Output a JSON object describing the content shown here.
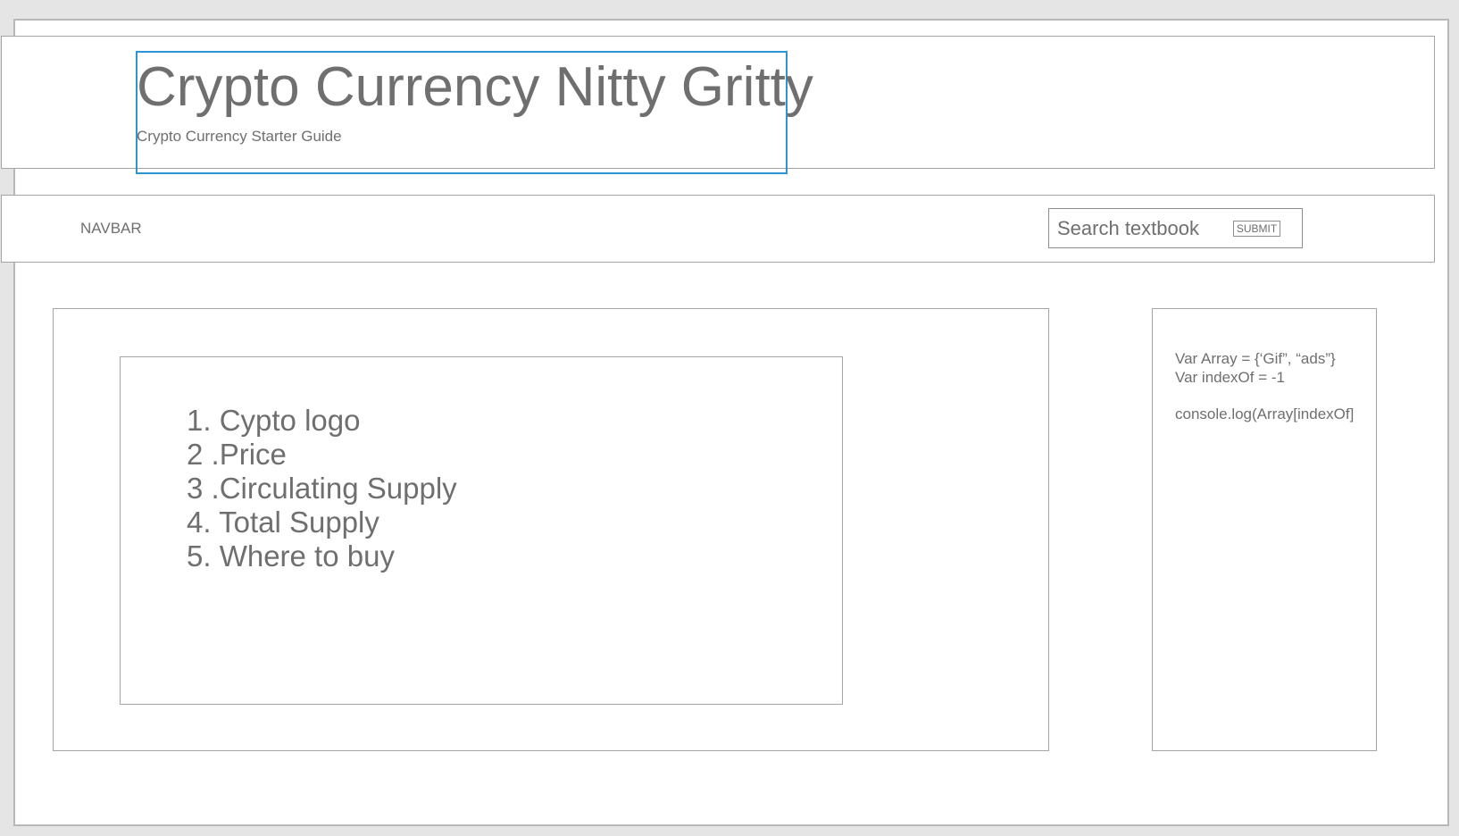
{
  "header": {
    "title": "Crypto Currency Nitty Gritty",
    "subtitle": "Crypto Currency Starter Guide"
  },
  "navbar": {
    "label": "NAVBAR",
    "search": {
      "text": "Search textbook",
      "submit_label": "SUBMIT"
    }
  },
  "main": {
    "items": [
      "1. Cypto logo",
      "2 .Price",
      "3 .Circulating Supply",
      "4. Total Supply",
      "5. Where to buy"
    ]
  },
  "sidebar": {
    "code_lines": [
      "Var Array = {‘Gif”, “ads”}",
      "Var indexOf = -1",
      "console.log(Array[indexOf]"
    ]
  },
  "colors": {
    "selection": "#2b95d6",
    "stroke": "#a5a5a5",
    "text": "#6f6f6f",
    "background": "#e5e5e5",
    "canvas": "#ffffff"
  }
}
